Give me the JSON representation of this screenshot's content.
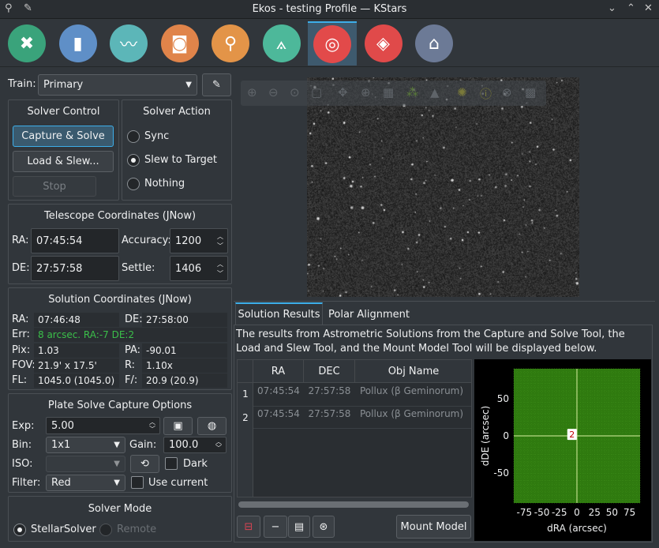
{
  "window": {
    "title": "Ekos - testing Profile — KStars"
  },
  "modules": [
    {
      "name": "setup-module-icon",
      "color": "#3aa37b",
      "glyph": "✖"
    },
    {
      "name": "scheduler-module-icon",
      "color": "#5f8fc7",
      "glyph": "▮"
    },
    {
      "name": "analyze-module-icon",
      "color": "#5cb6b8",
      "glyph": "〰"
    },
    {
      "name": "capture-module-icon",
      "color": "#e0844a",
      "glyph": "◙"
    },
    {
      "name": "focus-module-icon",
      "color": "#e39448",
      "glyph": "⚲"
    },
    {
      "name": "mount-module-icon",
      "color": "#4db89a",
      "glyph": "⟑"
    },
    {
      "name": "align-module-icon",
      "color": "#e24a4a",
      "glyph": "◎"
    },
    {
      "name": "guide-module-icon",
      "color": "#e04a4a",
      "glyph": "◈"
    },
    {
      "name": "observatory-module-icon",
      "color": "#6c7a96",
      "glyph": "⌂"
    }
  ],
  "train": {
    "label": "Train:",
    "value": "Primary"
  },
  "solver_control": {
    "title": "Solver Control",
    "capture_solve": "Capture & Solve",
    "load_slew": "Load & Slew...",
    "stop": "Stop"
  },
  "solver_action": {
    "title": "Solver Action",
    "options": [
      "Sync",
      "Slew to Target",
      "Nothing"
    ],
    "selected": "Slew to Target"
  },
  "telescope": {
    "title": "Telescope Coordinates (JNow)",
    "ra_label": "RA:",
    "ra": "07:45:54",
    "de_label": "DE:",
    "de": "27:57:58",
    "accuracy_label": "Accuracy:",
    "accuracy": "1200",
    "settle_label": "Settle:",
    "settle": "1406"
  },
  "solution": {
    "title": "Solution Coordinates (JNow)",
    "ra_label": "RA:",
    "ra": "07:46:48",
    "de_label": "DE:",
    "de": "27:58:00",
    "err_label": "Err:",
    "err": "8 arcsec. RA:-7 DE:2",
    "pix_label": "Pix:",
    "pix": "1.03",
    "pa_label": "PA:",
    "pa": "-90.01",
    "fov_label": "FOV:",
    "fov": "21.9' x 17.5'",
    "r_label": "R:",
    "r": "1.10x",
    "fl_label": "FL:",
    "fl": "1045.0 (1045.0)",
    "f_label": "F/:",
    "f": "20.9 (20.9)"
  },
  "plate_solve": {
    "title": "Plate Solve Capture Options",
    "exp_label": "Exp:",
    "exp": "5.00",
    "bin_label": "Bin:",
    "bin": "1x1",
    "gain_label": "Gain:",
    "gain": "100.0",
    "iso_label": "ISO:",
    "iso": "",
    "dark_label": "Dark",
    "filter_label": "Filter:",
    "filter": "Red",
    "use_current_label": "Use current"
  },
  "solver_mode": {
    "title": "Solver Mode",
    "stellar": "StellarSolver",
    "remote": "Remote"
  },
  "tabs": {
    "results": "Solution Results",
    "polar": "Polar Alignment"
  },
  "results": {
    "description": "The results from Astrometric Solutions from the Capture and Solve Tool, the Load and Slew Tool, and the Mount Model Tool will be displayed below.",
    "columns": [
      "RA",
      "DEC",
      "Obj Name"
    ],
    "rows": [
      {
        "num": "1",
        "ra": "07:45:54",
        "dec": "27:57:58",
        "obj": "Pollux (β Geminorum)"
      },
      {
        "num": "2",
        "ra": "07:45:54",
        "dec": "27:57:58",
        "obj": "Pollux (β Geminorum)"
      }
    ],
    "mount_model": "Mount Model"
  },
  "chart_data": {
    "type": "scatter",
    "xlabel": "dRA (arcsec)",
    "ylabel": "dDE (arcsec)",
    "xlim": [
      -90,
      90
    ],
    "ylim": [
      -90,
      90
    ],
    "xticks": [
      -75,
      -50,
      -25,
      0,
      25,
      50,
      75
    ],
    "yticks": [
      50,
      0,
      -50
    ],
    "grid": true,
    "background": "#2f7a0f",
    "points": [
      {
        "label": "2",
        "x": -7,
        "y": 2
      }
    ]
  }
}
